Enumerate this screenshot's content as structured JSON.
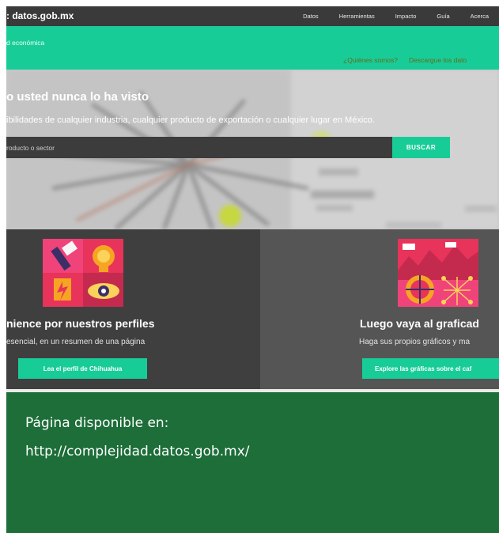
{
  "navbar": {
    "brand": ": datos.gob.mx",
    "links": [
      "Datos",
      "Herramientas",
      "Impacto",
      "Guía",
      "Acerca"
    ]
  },
  "subbar": {
    "title": "d económica",
    "links": [
      "¿Quiénes somos?",
      "Descargue los dato"
    ]
  },
  "hero": {
    "title": "o usted nunca lo ha visto",
    "subtitle": "ibilidades de cualquier industria, cualquier producto de exportación o cualquier lugar en México.",
    "search_placeholder": "roducto o sector",
    "search_button": "BUSCAR"
  },
  "cards": [
    {
      "title": "nience por nuestros perfiles",
      "description": "esencial, en un resumen de una página",
      "button": "Lea el perfil de Chihuahua"
    },
    {
      "title": "Luego vaya al graficad",
      "description": "Haga sus propios gráficos y ma",
      "button": "Explore las gráficas sobre el caf"
    }
  ],
  "info": {
    "line1": "Página disponible en:",
    "line2": "http://complejidad.datos.gob.mx/"
  },
  "colors": {
    "accent": "#18cc97",
    "navbar": "#3a3a3a",
    "info_panel": "#1d6e39"
  }
}
